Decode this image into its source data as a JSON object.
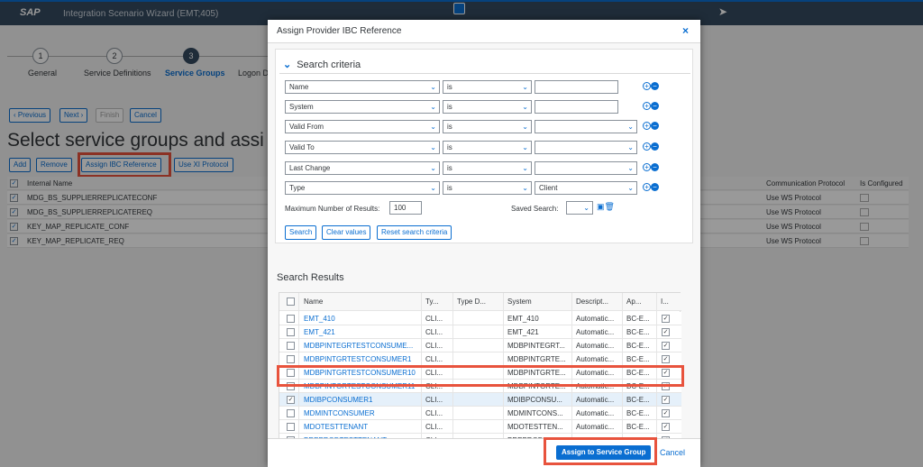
{
  "shell": {
    "logo": "SAP",
    "title": "Integration Scenario Wizard (EMT;405)"
  },
  "wizard": {
    "steps": [
      {
        "num": "1",
        "label": "General"
      },
      {
        "num": "2",
        "label": "Service Definitions"
      },
      {
        "num": "3",
        "label": "Service Groups"
      },
      {
        "label": "Logon Da"
      }
    ]
  },
  "nav": {
    "previous": "Previous",
    "next": "Next",
    "finish": "Finish",
    "cancel": "Cancel"
  },
  "page_title": "Select service groups and assi",
  "toolbar": {
    "add": "Add",
    "remove": "Remove",
    "assign_ibc": "Assign IBC Reference",
    "use_xi": "Use XI Protocol"
  },
  "bg_table": {
    "col_name": "Internal Name",
    "col_protocol": "Communication Protocol",
    "col_configured": "Is Configured",
    "rows": [
      {
        "name": "MDG_BS_SUPPLIERREPLICATECONF",
        "protocol": "Use WS Protocol"
      },
      {
        "name": "MDG_BS_SUPPLIERREPLICATEREQ",
        "protocol": "Use WS Protocol"
      },
      {
        "name": "KEY_MAP_REPLICATE_CONF",
        "protocol": "Use WS Protocol"
      },
      {
        "name": "KEY_MAP_REPLICATE_REQ",
        "protocol": "Use WS Protocol"
      }
    ]
  },
  "dialog": {
    "title": "Assign Provider IBC Reference",
    "close": "×",
    "search_criteria_title": "Search criteria",
    "criteria": [
      {
        "field": "Name",
        "op": "is",
        "value": "",
        "kind": "input"
      },
      {
        "field": "System",
        "op": "is",
        "value": "",
        "kind": "input"
      },
      {
        "field": "Valid From",
        "op": "is",
        "value": "",
        "kind": "select"
      },
      {
        "field": "Valid To",
        "op": "is",
        "value": "",
        "kind": "select"
      },
      {
        "field": "Last Change",
        "op": "is",
        "value": "",
        "kind": "select"
      },
      {
        "field": "Type",
        "op": "is",
        "value": "Client",
        "kind": "select"
      }
    ],
    "max_results_label": "Maximum Number of Results:",
    "max_results": "100",
    "saved_search_label": "Saved Search:",
    "search_btn": "Search",
    "clear_btn": "Clear values",
    "reset_btn": "Reset search criteria",
    "results_title": "Search Results",
    "columns": [
      "Name",
      "Ty...",
      "Type D...",
      "System",
      "Descript...",
      "Ap...",
      "I..."
    ],
    "rows": [
      {
        "name": "EMT_410",
        "type": "CLI...",
        "system": "EMT_410",
        "desc": "Automatic...",
        "app": "BC-E...",
        "selected": false
      },
      {
        "name": "EMT_421",
        "type": "CLI...",
        "system": "EMT_421",
        "desc": "Automatic...",
        "app": "BC-E...",
        "selected": false
      },
      {
        "name": "MDBPINTEGRTESTCONSUME...",
        "type": "CLI...",
        "system": "MDBPINTEGRT...",
        "desc": "Automatic...",
        "app": "BC-E...",
        "selected": false
      },
      {
        "name": "MDBPINTGRTESTCONSUMER1",
        "type": "CLI...",
        "system": "MDBPINTGRTE...",
        "desc": "Automatic...",
        "app": "BC-E...",
        "selected": false
      },
      {
        "name": "MDBPINTGRTESTCONSUMER10",
        "type": "CLI...",
        "system": "MDBPINTGRTE...",
        "desc": "Automatic...",
        "app": "BC-E...",
        "selected": false
      },
      {
        "name": "MDBPINTGRTESTCONSUMER11",
        "type": "CLI...",
        "system": "MDBPINTGRTE...",
        "desc": "Automatic...",
        "app": "BC-E...",
        "selected": false
      },
      {
        "name": "MDIBPCONSUMER1",
        "type": "CLI...",
        "system": "MDIBPCONSU...",
        "desc": "Automatic...",
        "app": "BC-E...",
        "selected": true
      },
      {
        "name": "MDMINTCONSUMER",
        "type": "CLI...",
        "system": "MDMINTCONS...",
        "desc": "Automatic...",
        "app": "BC-E...",
        "selected": false
      },
      {
        "name": "MDOTESTTENANT",
        "type": "CLI...",
        "system": "MDOTESTTEN...",
        "desc": "Automatic...",
        "app": "BC-E...",
        "selected": false
      },
      {
        "name": "PREPRODTESTTENANT",
        "type": "CLI...",
        "system": "PREPRODTEST...",
        "desc": "Automatic...",
        "app": "BC-E...",
        "selected": false
      }
    ],
    "assign_btn": "Assign to Service Group",
    "cancel": "Cancel"
  },
  "colors": {
    "accent": "#0a6ed1",
    "shell": "#354a5f",
    "highlight": "#e8533d"
  }
}
